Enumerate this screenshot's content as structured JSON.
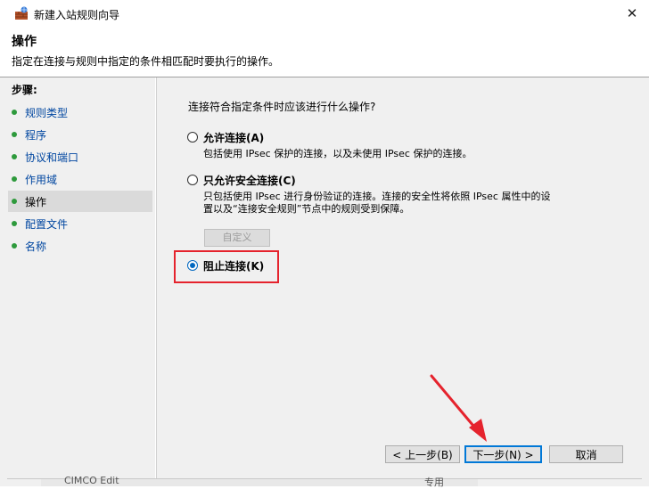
{
  "window": {
    "title": "新建入站规则向导",
    "close_glyph": "✕"
  },
  "header": {
    "title": "操作",
    "description": "指定在连接与规则中指定的条件相匹配时要执行的操作。"
  },
  "steps": {
    "heading": "步骤:",
    "items": [
      {
        "label": "规则类型",
        "current": false
      },
      {
        "label": "程序",
        "current": false
      },
      {
        "label": "协议和端口",
        "current": false
      },
      {
        "label": "作用域",
        "current": false
      },
      {
        "label": "操作",
        "current": true
      },
      {
        "label": "配置文件",
        "current": false
      },
      {
        "label": "名称",
        "current": false
      }
    ]
  },
  "content": {
    "question": "连接符合指定条件时应该进行什么操作?",
    "options": [
      {
        "label": "允许连接(A)",
        "description": "包括使用 IPsec 保护的连接，以及未使用 IPsec 保护的连接。",
        "selected": false
      },
      {
        "label": "只允许安全连接(C)",
        "description_line1": "只包括使用 IPsec 进行身份验证的连接。连接的安全性将依照 IPsec 属性中的设",
        "description_line2": "置以及“连接安全规则”节点中的规则受到保障。",
        "selected": false
      },
      {
        "label": "阻止连接(K)",
        "selected": true
      }
    ],
    "customize_button": "自定义"
  },
  "buttons": {
    "back": "< 上一步(B)",
    "next": "下一步(N) >",
    "cancel": "取消"
  },
  "background": {
    "peek_left": "CIMCO Edit",
    "peek_right": "专用"
  },
  "colors": {
    "highlight": "#e5232d",
    "radio_selected": "#0067c0",
    "step_link": "#0046a0",
    "step_bullet": "#2e9a3c"
  }
}
